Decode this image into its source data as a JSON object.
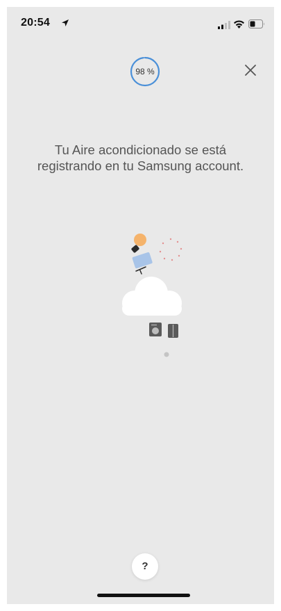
{
  "status_bar": {
    "time": "20:54",
    "icons": [
      "location-arrow-icon",
      "cellular-signal-icon",
      "wifi-icon",
      "battery-icon"
    ]
  },
  "progress": {
    "label": "98 %",
    "value_percent": 98,
    "color": "#4a90d9"
  },
  "close": {
    "icon": "close-icon"
  },
  "message": {
    "line1": "Tu Aire acondicionado se está",
    "line2": "registrando en tu Samsung account."
  },
  "illustration": {
    "icons": [
      "lightbulb-icon",
      "smart-tv-icon",
      "cloud-icon",
      "washer-icon",
      "refrigerator-icon",
      "loading-dots-icon"
    ]
  },
  "help": {
    "label": "?"
  },
  "colors": {
    "background": "#e9e9e9",
    "accent": "#4a90d9",
    "text": "#555555"
  }
}
